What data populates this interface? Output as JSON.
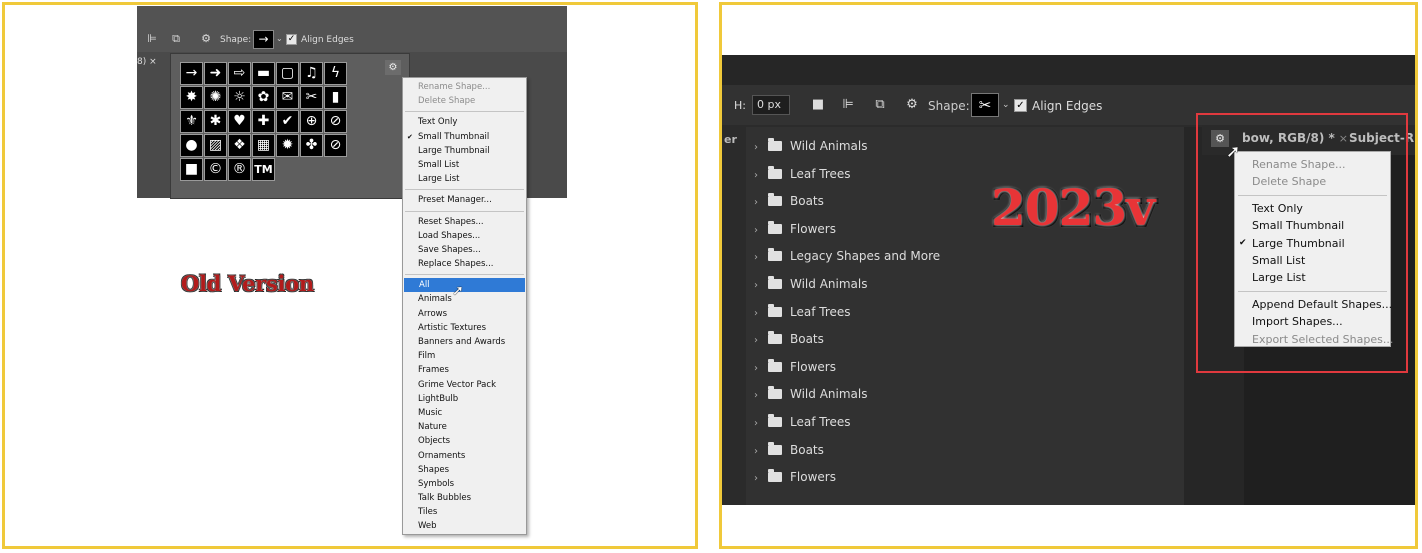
{
  "old_version": {
    "title": "Old Version",
    "toolbar": {
      "shape_label": "Shape:",
      "shape_swatch": "→",
      "align_edges_label": "Align Edges",
      "align_edges_checked": true,
      "tab_fragment": "8) ×"
    },
    "shape_grid": [
      "→",
      "➜",
      "⇨",
      "▬",
      "▢",
      "♫",
      "ϟ",
      "✸",
      "✺",
      "☼",
      "✿",
      "✉",
      "✂",
      "▮",
      "⚜",
      "✱",
      "♥",
      "✚",
      "✔",
      "⊕",
      "⊘",
      "●",
      "▨",
      "❖",
      "▦",
      "✹",
      "✤",
      "⊘",
      "■",
      "©",
      "®",
      "TM"
    ],
    "menu": {
      "group1": [
        "Rename Shape...",
        "Delete Shape"
      ],
      "group2": [
        "Text Only",
        "Small Thumbnail",
        "Large Thumbnail",
        "Small List",
        "Large List"
      ],
      "group2_checked": "Small Thumbnail",
      "group3": [
        "Preset Manager..."
      ],
      "group4": [
        "Reset Shapes...",
        "Load Shapes...",
        "Save Shapes...",
        "Replace Shapes..."
      ],
      "group5": [
        "All",
        "Animals",
        "Arrows",
        "Artistic Textures",
        "Banners and Awards",
        "Film",
        "Frames",
        "Grime Vector Pack",
        "LightBulb",
        "Music",
        "Nature",
        "Objects",
        "Ornaments",
        "Shapes",
        "Symbols",
        "Talk Bubbles",
        "Tiles",
        "Web"
      ],
      "group5_highlight": "All"
    }
  },
  "new_version": {
    "title": "2023v",
    "toolbar": {
      "h_label": "H:",
      "h_value": "0 px",
      "shape_label": "Shape:",
      "shape_swatch": "✂",
      "align_edges_label": "Align Edges",
      "align_edges_checked": true
    },
    "side_label": "er",
    "doc_tab_1": "bow, RGB/8) *",
    "doc_tab_close": "×",
    "doc_tab_2": "Subject-R",
    "folders": [
      "Wild Animals",
      "Leaf Trees",
      "Boats",
      "Flowers",
      "Legacy Shapes and More",
      "Wild Animals",
      "Leaf Trees",
      "Boats",
      "Flowers",
      "Wild Animals",
      "Leaf Trees",
      "Boats",
      "Flowers"
    ],
    "menu": {
      "group1": [
        "Rename Shape...",
        "Delete Shape"
      ],
      "group2": [
        "Text Only",
        "Small Thumbnail",
        "Large Thumbnail",
        "Small List",
        "Large List"
      ],
      "group2_checked": "Large Thumbnail",
      "group3": [
        "Append Default Shapes...",
        "Import Shapes...",
        "Export Selected Shapes..."
      ],
      "group3_disabled": "Export Selected Shapes..."
    },
    "highlight_color": "#e0393e"
  },
  "colors": {
    "frame_border": "#f0c93a",
    "old_title_color": "#b21b1b",
    "new_title_color": "#e83437",
    "menu_highlight": "#2f7ad6"
  }
}
